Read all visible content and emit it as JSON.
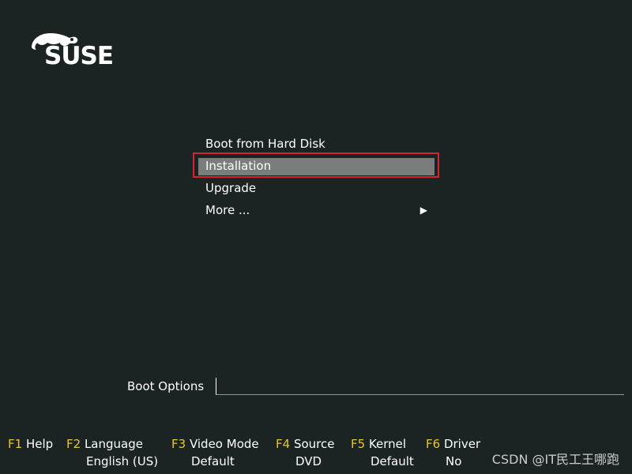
{
  "logo": {
    "text": "SUSE"
  },
  "menu": {
    "items": [
      {
        "label": "Boot from Hard Disk"
      },
      {
        "label": "Installation"
      },
      {
        "label": "Upgrade"
      },
      {
        "label": "More ...",
        "arrow": "▶"
      }
    ],
    "selected_index": 1
  },
  "boot_options": {
    "label": "Boot Options",
    "value": ""
  },
  "fkeys": [
    {
      "key": "F1",
      "name": "Help",
      "value": ""
    },
    {
      "key": "F2",
      "name": "Language",
      "value": "English (US)"
    },
    {
      "key": "F3",
      "name": "Video Mode",
      "value": "Default"
    },
    {
      "key": "F4",
      "name": "Source",
      "value": "DVD"
    },
    {
      "key": "F5",
      "name": "Kernel",
      "value": "Default"
    },
    {
      "key": "F6",
      "name": "Driver",
      "value": "No"
    }
  ],
  "watermark": {
    "text": "CSDN @IT民工王哪跑"
  },
  "colors": {
    "background": "#1b2422",
    "fkey_accent": "#e6c43a",
    "selection_bg": "#7b7d7d",
    "highlight_border": "#d9232b"
  }
}
